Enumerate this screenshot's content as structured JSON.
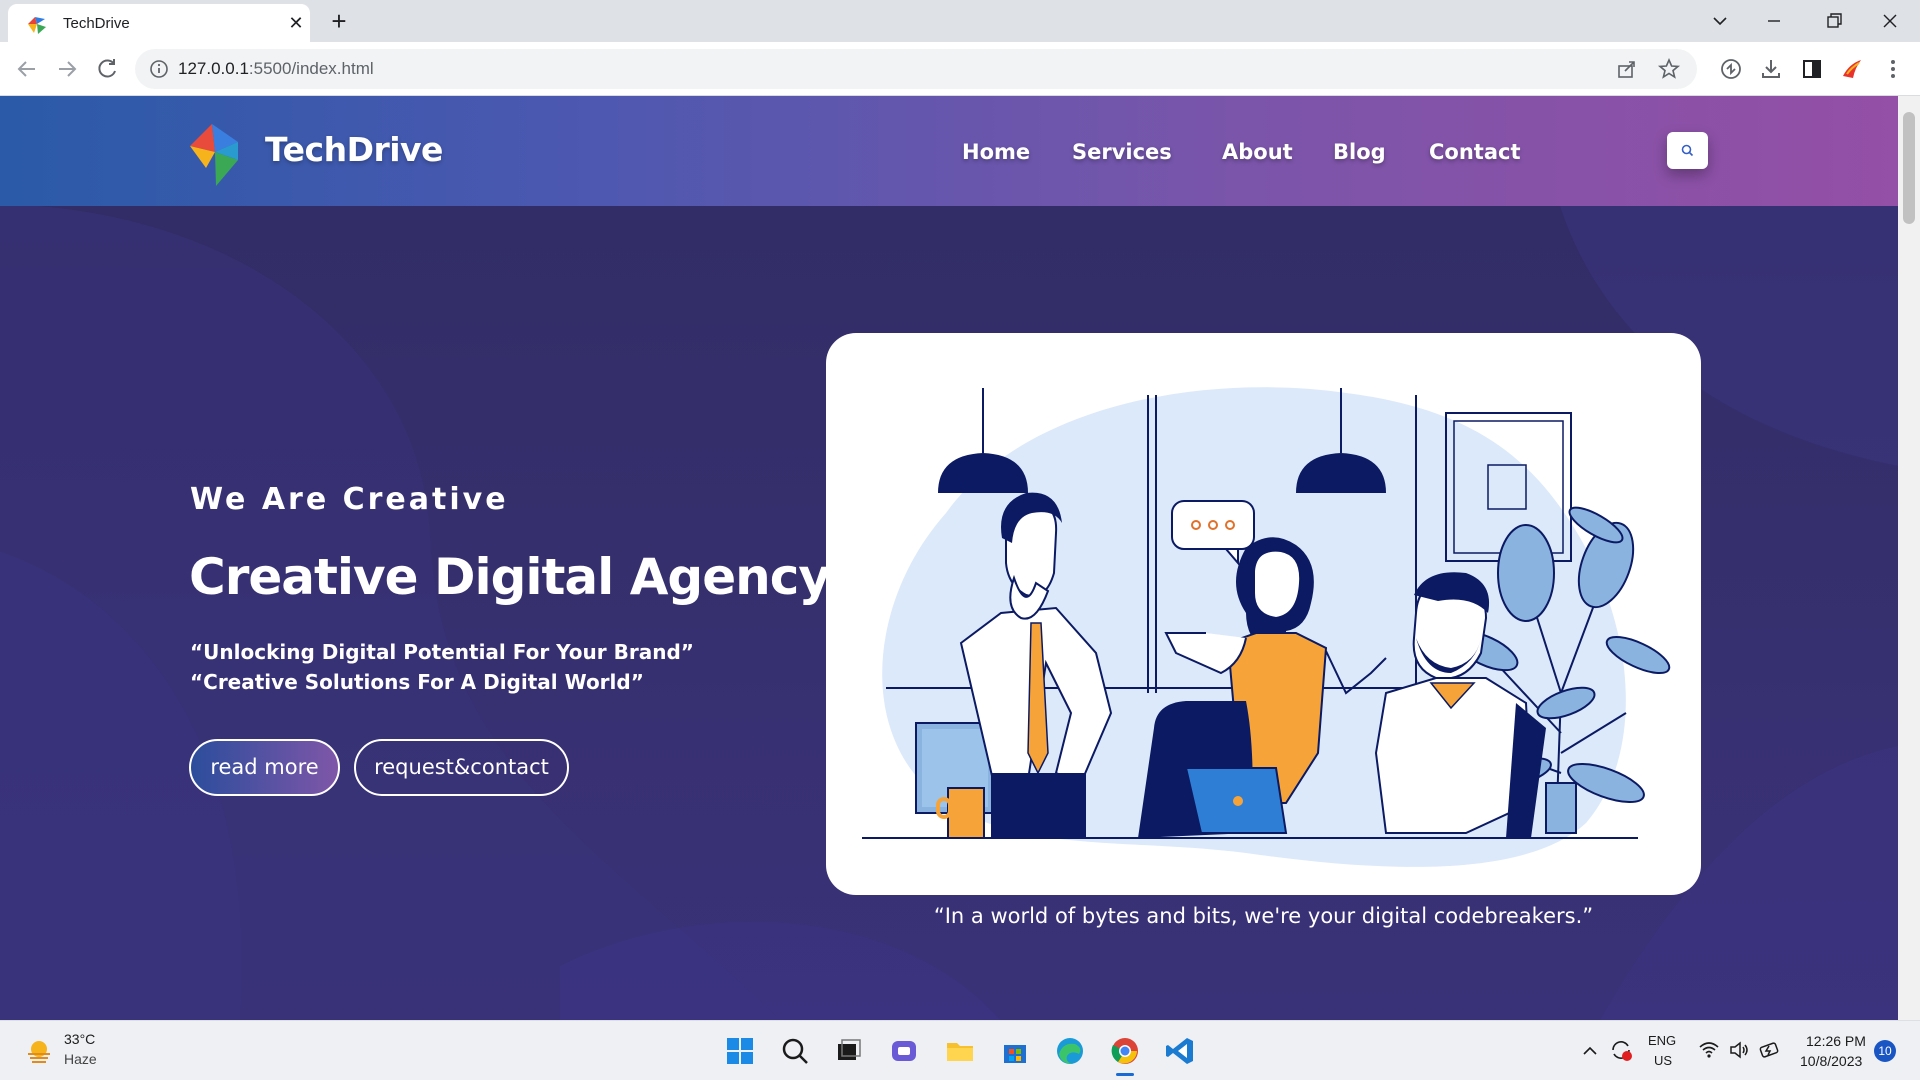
{
  "browser": {
    "tab_title": "TechDrive",
    "url_host": "127.0.0.1",
    "url_path": ":5500/index.html",
    "new_tab_label": "+",
    "close_tab_label": "✕"
  },
  "site": {
    "brand": "TechDrive",
    "nav": [
      "Home",
      "Services",
      "About",
      "Blog",
      "Contact"
    ]
  },
  "hero": {
    "tagline": "We Are Creative",
    "headline": "Creative Digital Agency",
    "quote1": "“Unlocking Digital Potential For Your Brand”",
    "quote2": "“Creative Solutions For A Digital World”",
    "btn_primary": "read more",
    "btn_secondary": "request&contact",
    "image_caption": "“In a world of bytes and bits, we're your digital codebreakers.”"
  },
  "taskbar": {
    "weather_temp": "33°C",
    "weather_desc": "Haze",
    "lang_top": "ENG",
    "lang_bottom": "US",
    "time": "12:26 PM",
    "date": "10/8/2023",
    "notification_count": "10"
  },
  "colors": {
    "header_start": "#2a5aa8",
    "header_end": "#944fa6",
    "hero_bg": "#332e6c",
    "illustration_navy": "#0b1a63",
    "illustration_orange": "#f6a43a",
    "illustration_blue": "#dce9fa"
  }
}
